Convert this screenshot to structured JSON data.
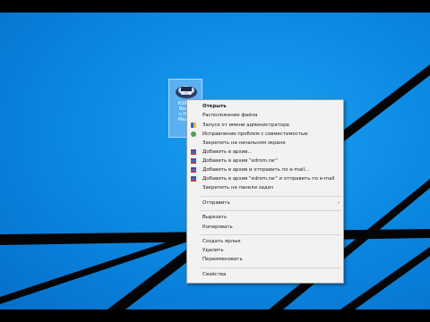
{
  "desktop_icon": {
    "label": "Sorrow Knocking at Shutter Gate",
    "label_lines": "KSIMO\nBooxi\nn Hny\nPlease"
  },
  "context_menu": {
    "items": [
      {
        "label": "Открыть",
        "bold": true,
        "icon": null
      },
      {
        "label": "Расположение файла",
        "icon": null
      },
      {
        "label": "Запуск от имени администратора",
        "icon": "uac-shield-icon"
      },
      {
        "label": "Исправление проблем с совместимостью",
        "icon": "compatibility-icon"
      },
      {
        "label": "Закрепить на начальном экране",
        "icon": null
      },
      {
        "label": "Добавить в архив...",
        "icon": "winrar-icon"
      },
      {
        "label": "Добавить в архив \"edrom.rar\"",
        "icon": "winrar-icon"
      },
      {
        "label": "Добавить в архив и отправить по e-mail...",
        "icon": "winrar-icon"
      },
      {
        "label": "Добавить в архив \"edrom.rar\" и отправить по e-mail",
        "icon": "winrar-icon"
      },
      {
        "label": "Закрепить на панели задач",
        "icon": null
      },
      {
        "label": "Отправить",
        "submenu": true,
        "icon": null
      },
      {
        "label": "Вырезать",
        "icon": null
      },
      {
        "label": "Копировать",
        "icon": null
      },
      {
        "label": "Создать ярлык",
        "icon": null
      },
      {
        "label": "Удалить",
        "icon": null
      },
      {
        "label": "Переименовать",
        "icon": null
      },
      {
        "label": "Свойства",
        "icon": null
      }
    ],
    "submenu_arrow": "›"
  },
  "colors": {
    "desktop": "#0a86e0",
    "menu_bg": "#f2f2f2",
    "stripe": "#050505"
  }
}
